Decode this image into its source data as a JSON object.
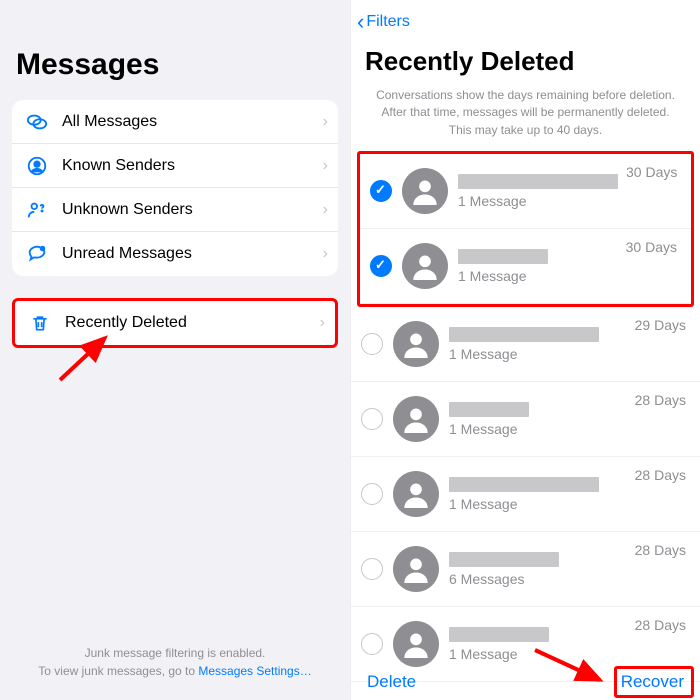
{
  "left": {
    "title": "Messages",
    "items": [
      {
        "label": "All Messages"
      },
      {
        "label": "Known Senders"
      },
      {
        "label": "Unknown Senders"
      },
      {
        "label": "Unread Messages"
      }
    ],
    "deleted": {
      "label": "Recently Deleted"
    },
    "footer1": "Junk message filtering is enabled.",
    "footer2a": "To view junk messages, go to ",
    "footer2b": "Messages Settings…"
  },
  "right": {
    "back": "Filters",
    "title": "Recently Deleted",
    "note": "Conversations show the days remaining before deletion. After that time, messages will be permanently deleted. This may take up to 40 days.",
    "rows": [
      {
        "selected": true,
        "name_w": 160,
        "count": "1 Message",
        "days": "30 Days"
      },
      {
        "selected": true,
        "name_w": 90,
        "count": "1 Message",
        "days": "30 Days"
      },
      {
        "selected": false,
        "name_w": 150,
        "count": "1 Message",
        "days": "29 Days"
      },
      {
        "selected": false,
        "name_w": 80,
        "count": "1 Message",
        "days": "28 Days"
      },
      {
        "selected": false,
        "name_w": 150,
        "count": "1 Message",
        "days": "28 Days"
      },
      {
        "selected": false,
        "name_w": 110,
        "count": "6 Messages",
        "days": "28 Days"
      },
      {
        "selected": false,
        "name_w": 100,
        "count": "1 Message",
        "days": "28 Days"
      }
    ],
    "delete": "Delete",
    "recover": "Recover"
  }
}
